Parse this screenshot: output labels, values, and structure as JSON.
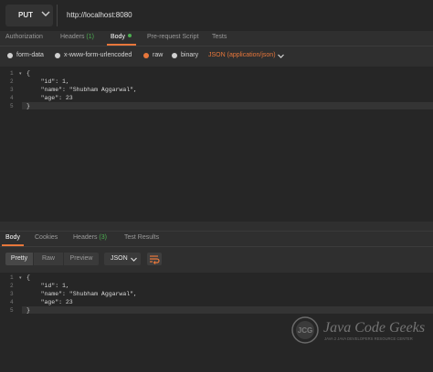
{
  "request": {
    "method": "PUT",
    "url": "http://localhost:8080",
    "tabs": [
      {
        "label": "Authorization",
        "active": false
      },
      {
        "label": "Headers",
        "count": "(1)",
        "active": false
      },
      {
        "label": "Body",
        "active": true
      },
      {
        "label": "Pre-request Script",
        "active": false
      },
      {
        "label": "Tests",
        "active": false
      }
    ],
    "body_types": [
      {
        "label": "form-data",
        "selected": false
      },
      {
        "label": "x-www-form-urlencoded",
        "selected": false
      },
      {
        "label": "raw",
        "selected": true
      },
      {
        "label": "binary",
        "selected": false
      }
    ],
    "content_type": "JSON (application/json)",
    "code_lines": [
      "{",
      "    \"id\": 1,",
      "    \"name\": \"Shubham Aggarwal\",",
      "    \"age\": 23",
      "}"
    ],
    "line_numbers": [
      "1",
      "2",
      "3",
      "4",
      "5"
    ]
  },
  "response": {
    "tabs": [
      {
        "label": "Body",
        "active": true
      },
      {
        "label": "Cookies",
        "active": false
      },
      {
        "label": "Headers",
        "count": "(3)",
        "active": false
      },
      {
        "label": "Test Results",
        "active": false
      }
    ],
    "view_modes": [
      "Pretty",
      "Raw",
      "Preview"
    ],
    "active_view": "Pretty",
    "format": "JSON",
    "code_lines": [
      "{",
      "    \"id\": 1,",
      "    \"name\": \"Shubham Aggarwal\",",
      "    \"age\": 23",
      "}"
    ],
    "line_numbers": [
      "1",
      "2",
      "3",
      "4",
      "5"
    ]
  },
  "watermark": {
    "logo_text": "JCG",
    "title": "Java Code Geeks",
    "tagline": "JAVA 2 JAVA DEVELOPERS RESOURCE CENTER"
  },
  "colors": {
    "accent": "#e8773b",
    "active_badge": "#4caf50",
    "background": "#2f2f2f",
    "editor_bg": "#262626"
  },
  "icons": [
    "chevron-down-icon",
    "wrap-lines-icon"
  ]
}
